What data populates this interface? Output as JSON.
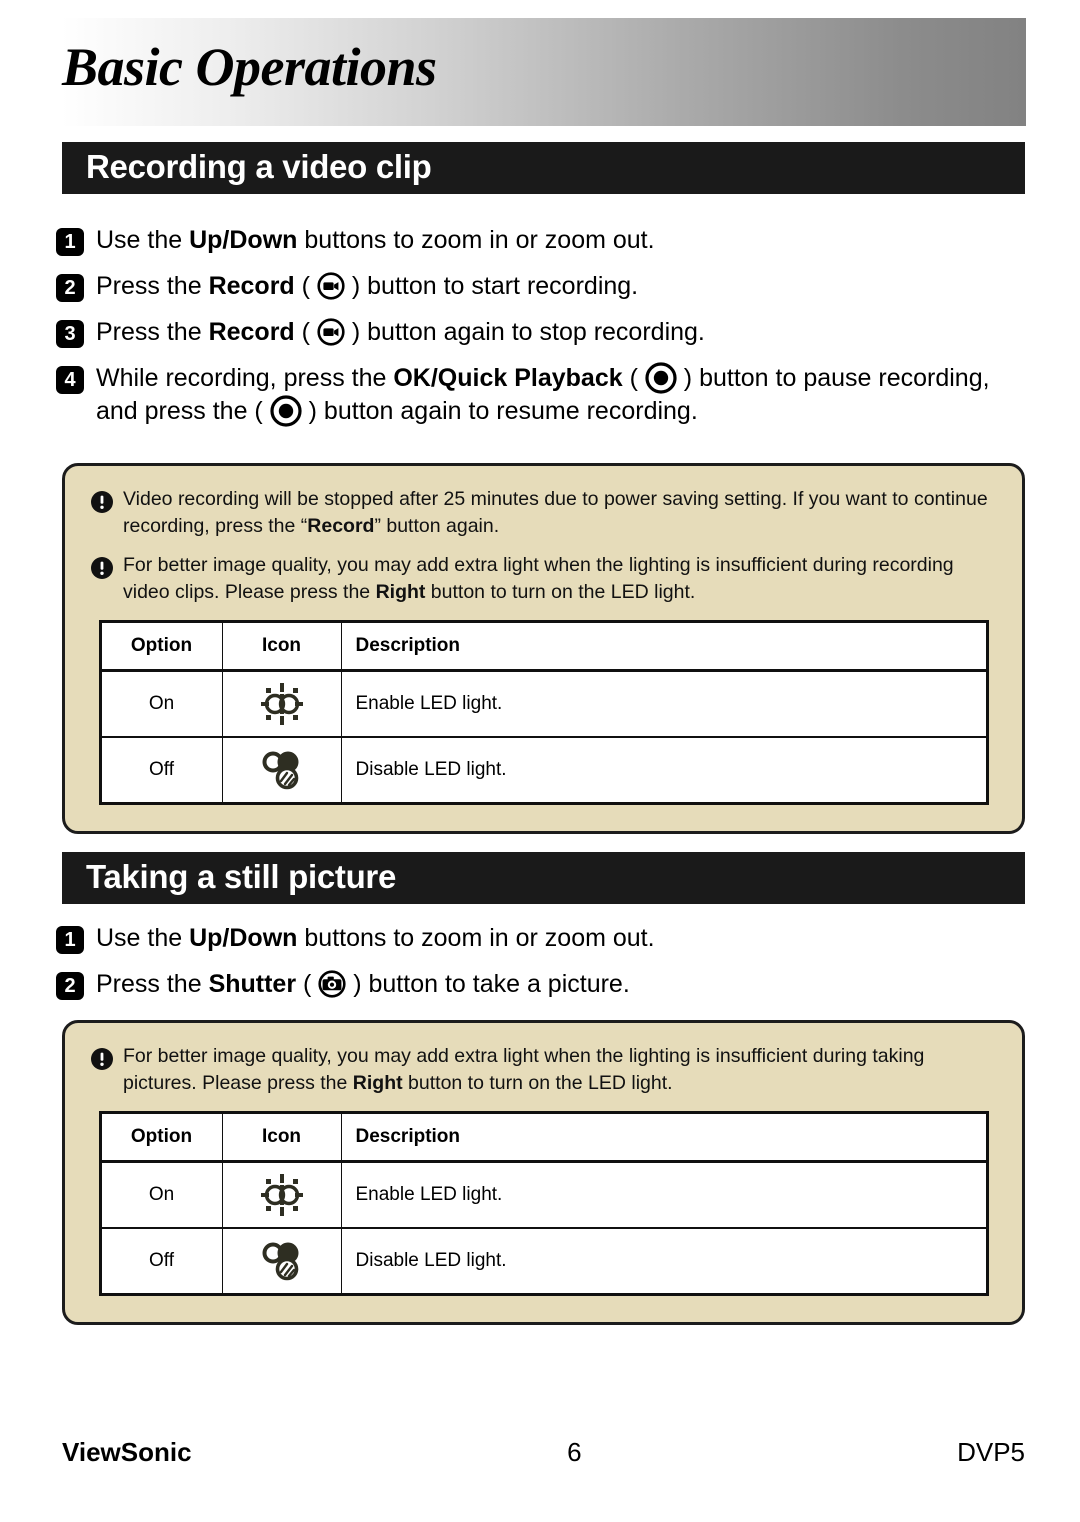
{
  "page": {
    "title": "Basic Operations"
  },
  "sections": [
    {
      "heading": "Recording a video clip",
      "steps": [
        {
          "number": "1",
          "parts": [
            {
              "t": "text",
              "v": "Use the "
            },
            {
              "t": "bold",
              "v": "Up/Down"
            },
            {
              "t": "text",
              "v": " buttons to zoom in or zoom out."
            }
          ]
        },
        {
          "number": "2",
          "parts": [
            {
              "t": "text",
              "v": "Press the "
            },
            {
              "t": "bold",
              "v": "Record"
            },
            {
              "t": "text",
              "v": " ( "
            },
            {
              "t": "icon",
              "v": "record-button-icon"
            },
            {
              "t": "text",
              "v": " ) button to start recording."
            }
          ]
        },
        {
          "number": "3",
          "parts": [
            {
              "t": "text",
              "v": "Press the "
            },
            {
              "t": "bold",
              "v": "Record"
            },
            {
              "t": "text",
              "v": " ( "
            },
            {
              "t": "icon",
              "v": "record-button-icon"
            },
            {
              "t": "text",
              "v": " ) button again to stop recording."
            }
          ]
        },
        {
          "number": "4",
          "parts": [
            {
              "t": "text",
              "v": "While recording, press the "
            },
            {
              "t": "bold",
              "v": "OK/Quick Playback"
            },
            {
              "t": "text",
              "v": " ( "
            },
            {
              "t": "icon-big",
              "v": "ok-quick-playback-button-icon"
            },
            {
              "t": "text",
              "v": " ) button  to pause recording, and press the ( "
            },
            {
              "t": "icon-big",
              "v": "ok-quick-playback-button-icon"
            },
            {
              "t": "text",
              "v": " ) button again to resume recording."
            }
          ]
        }
      ],
      "note": {
        "items": [
          [
            {
              "t": "text",
              "v": "Video recording will be stopped after 25 minutes due to power saving setting.  If you want to continue recording, press the “"
            },
            {
              "t": "bold",
              "v": "Record"
            },
            {
              "t": "text",
              "v": "” button again."
            }
          ],
          [
            {
              "t": "text",
              "v": "For better image quality, you may add extra light when the lighting is insufficient during recording video clips. Please press the "
            },
            {
              "t": "bold",
              "v": "Right"
            },
            {
              "t": "text",
              "v": " button to turn on the LED light."
            }
          ]
        ],
        "table": {
          "headers": [
            "Option",
            "Icon",
            "Description"
          ],
          "rows": [
            {
              "option": "On",
              "icon": "led-on-icon",
              "description": "Enable LED light."
            },
            {
              "option": "Off",
              "icon": "led-off-icon",
              "description": "Disable LED light."
            }
          ]
        }
      }
    },
    {
      "heading": "Taking a still picture",
      "steps": [
        {
          "number": "1",
          "parts": [
            {
              "t": "text",
              "v": "Use the "
            },
            {
              "t": "bold",
              "v": "Up/Down"
            },
            {
              "t": "text",
              "v": " buttons to zoom in or zoom out."
            }
          ]
        },
        {
          "number": "2",
          "parts": [
            {
              "t": "text",
              "v": "Press the "
            },
            {
              "t": "bold",
              "v": "Shutter"
            },
            {
              "t": "text",
              "v": " ( "
            },
            {
              "t": "icon",
              "v": "shutter-button-icon"
            },
            {
              "t": "text",
              "v": " ) button to take a picture."
            }
          ]
        }
      ],
      "note": {
        "items": [
          [
            {
              "t": "text",
              "v": "For better image quality, you may add extra light when the lighting is insufficient during taking pictures. Please press the "
            },
            {
              "t": "bold",
              "v": "Right"
            },
            {
              "t": "text",
              "v": " button to turn on the LED light."
            }
          ]
        ],
        "table": {
          "headers": [
            "Option",
            "Icon",
            "Description"
          ],
          "rows": [
            {
              "option": "On",
              "icon": "led-on-icon",
              "description": "Enable LED light."
            },
            {
              "option": "Off",
              "icon": "led-off-icon",
              "description": "Disable LED light."
            }
          ]
        }
      }
    }
  ],
  "footer": {
    "brand": "ViewSonic",
    "page_number": "6",
    "model": "DVP5"
  },
  "colors": {
    "note_background": "#e6dcba",
    "note_border": "#1c1c1c",
    "section_bar": "#1a1a1a",
    "text": "#000000",
    "header_gradient_end": "#828282"
  }
}
